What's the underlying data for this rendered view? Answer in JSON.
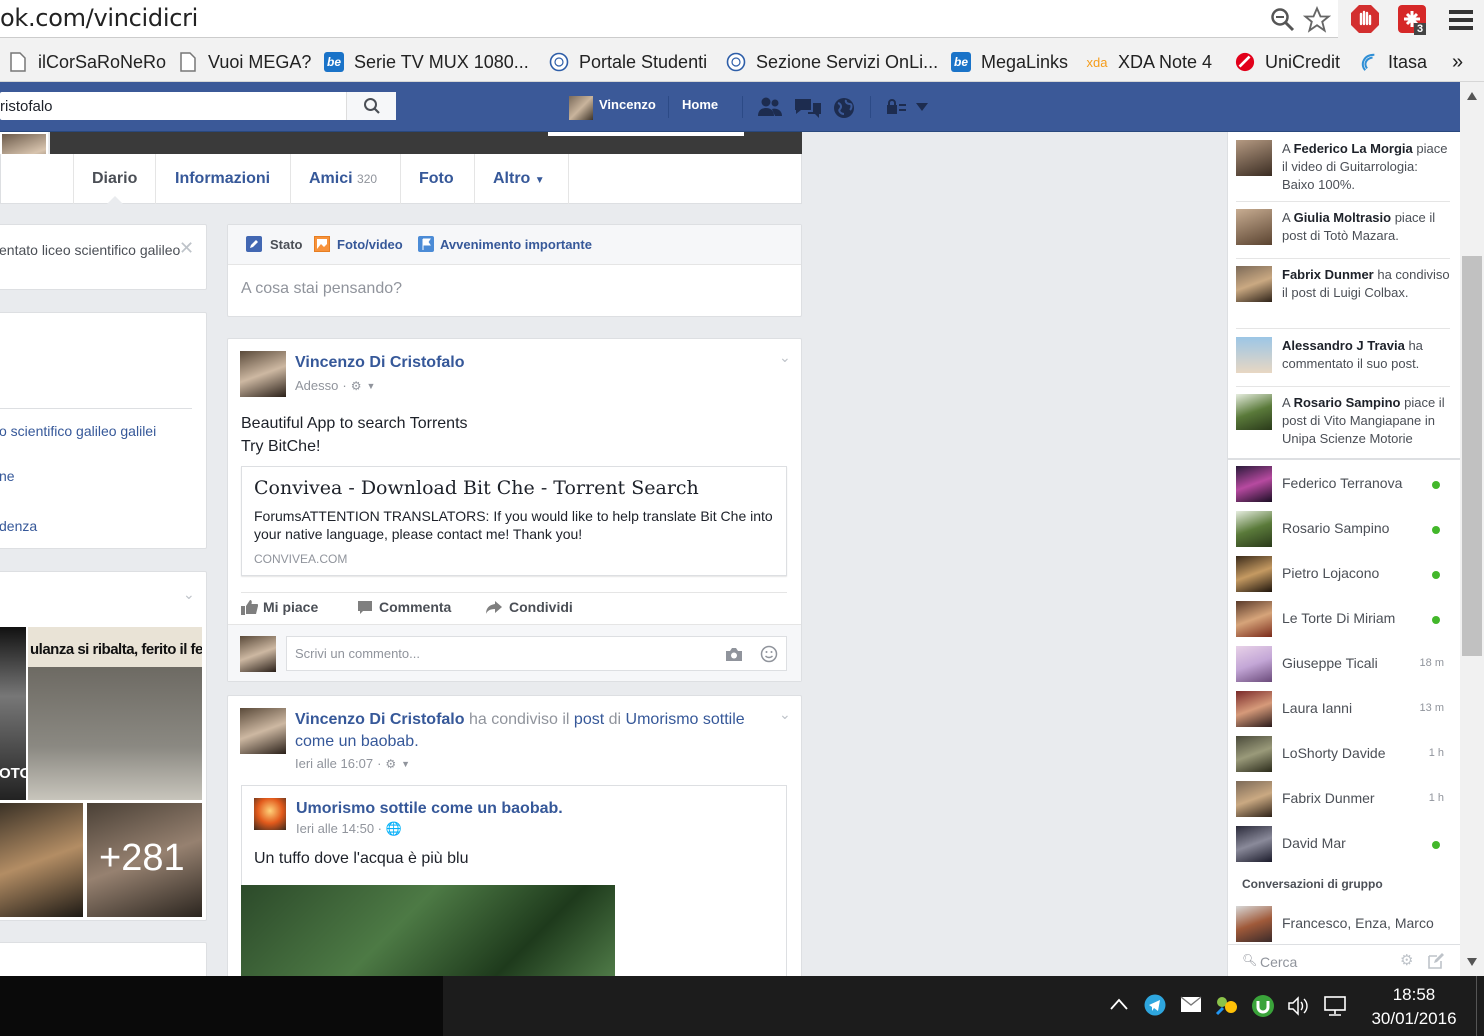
{
  "browser": {
    "url": "ok.com/vincidicri",
    "bookmarks": [
      {
        "label": "ilCorSaRoNeRo",
        "icon": "page-icon"
      },
      {
        "label": "Vuoi MEGA?",
        "icon": "page-icon"
      },
      {
        "label": "Serie TV MUX 1080...",
        "icon": "be-icon"
      },
      {
        "label": "Portale Studenti",
        "icon": "seal-icon"
      },
      {
        "label": "Sezione Servizi OnLi...",
        "icon": "seal-icon"
      },
      {
        "label": "MegaLinks",
        "icon": "be-icon"
      },
      {
        "label": "XDA Note 4",
        "icon": "xda-icon"
      },
      {
        "label": "UniCredit",
        "icon": "unicredit-icon"
      },
      {
        "label": "Itasa",
        "icon": "itasa-icon"
      }
    ],
    "extension_badge": "3",
    "more": "»"
  },
  "fbbar": {
    "search_value": "ristofalo",
    "user_name": "Vincenzo",
    "home": "Home"
  },
  "profile_tabs": [
    {
      "label": "Diario"
    },
    {
      "label": "Informazioni"
    },
    {
      "label": "Amici",
      "count": "320"
    },
    {
      "label": "Foto"
    },
    {
      "label": "Altro"
    }
  ],
  "left": {
    "studied_text": "entato liceo scientifico galileo",
    "about_1": "o scientifico galileo galilei",
    "about_2": "ne",
    "about_3": "denza",
    "photo_1_caption": "ulanza si ribalta, ferito il fe",
    "photo_2_caption": "OTO",
    "more_count": "+281"
  },
  "composer": {
    "stato": "Stato",
    "foto": "Foto/video",
    "evento": "Avvenimento importante",
    "placeholder": "A cosa stai pensando?"
  },
  "post1": {
    "author": "Vincenzo Di Cristofalo",
    "time": "Adesso",
    "text_1": "Beautiful App to search Torrents",
    "text_2": "Try BitChe!",
    "link_title": "Convivea - Download Bit Che - Torrent Search",
    "link_desc": "ForumsATTENTION TRANSLATORS: If you would like to help translate Bit Che into your native language, please contact me! Thank you!",
    "link_domain": "CONVIVEA.COM",
    "like": "Mi piace",
    "comment": "Commenta",
    "share": "Condividi",
    "comment_placeholder": "Scrivi un commento..."
  },
  "post2": {
    "author": "Vincenzo Di Cristofalo",
    "shared": "ha condiviso il",
    "post_word": "post",
    "of": "di",
    "page_1": "Umorismo sottile",
    "page_2": "come un baobab.",
    "time": "Ieri alle 16:07",
    "inner_page": "Umorismo sottile come un baobab.",
    "inner_time": "Ieri alle 14:50",
    "inner_text": "Un tuffo dove l'acqua è più blu"
  },
  "ticker": [
    {
      "pre": "A ",
      "name": "Federico La Morgia",
      "post": " piace il video di Guitarrologia: Baixo 100%."
    },
    {
      "pre": "A ",
      "name": "Giulia Moltrasio",
      "post": " piace il post di Totò Mazara."
    },
    {
      "pre": "",
      "name": "Fabrix Dunmer",
      "post": " ha condiviso il post di Luigi Colbax."
    },
    {
      "pre": "",
      "name": "Alessandro J Travia",
      "post": " ha commentato il suo post."
    },
    {
      "pre": "A ",
      "name": "Rosario Sampino",
      "post": " piace il post di Vito Mangiapane in Unipa Scienze Motorie"
    }
  ],
  "chat": [
    {
      "name": "Federico Terranova",
      "status": "",
      "online": true
    },
    {
      "name": "Rosario Sampino",
      "status": "",
      "online": true
    },
    {
      "name": "Pietro Lojacono",
      "status": "",
      "online": true
    },
    {
      "name": "Le Torte Di Miriam",
      "status": "",
      "online": true
    },
    {
      "name": "Giuseppe Ticali",
      "status": "18 m",
      "online": false
    },
    {
      "name": "Laura Ianni",
      "status": "13 m",
      "online": false
    },
    {
      "name": "LoShorty Davide",
      "status": "1 h",
      "online": false
    },
    {
      "name": "Fabrix Dunmer",
      "status": "1 h",
      "online": false
    },
    {
      "name": "David Mar",
      "status": "",
      "online": true
    }
  ],
  "group_header": "Conversazioni di gruppo",
  "group_chat": "Francesco, Enza, Marco",
  "chat_search": "Cerca",
  "taskbar": {
    "time": "18:58",
    "date": "30/01/2016"
  }
}
